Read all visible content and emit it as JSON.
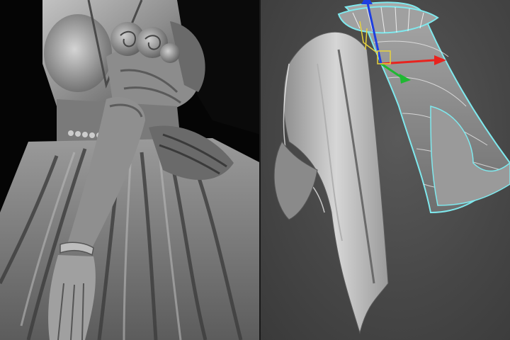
{
  "panels": {
    "left": {
      "render_mode": "sculpt-clay-render",
      "subject": "figure-dress-closeup"
    },
    "right": {
      "render_mode": "viewport-shaded-with-selection",
      "subject": "layered-skirt-mesh"
    }
  },
  "colors": {
    "left_background": "#050505",
    "clay_light": "#b9b9b9",
    "clay_mid": "#8a8a8a",
    "clay_dark": "#3c3c3c",
    "viewport_background": "#4a4a4a",
    "selection_outline": "#7fe9ee",
    "gizmo_x": "#e8231e",
    "gizmo_y": "#1fb832",
    "gizmo_z": "#1f3fe0",
    "wire_yellow": "#e8d23c"
  },
  "gizmo": {
    "axes": [
      "x-axis",
      "y-axis",
      "z-axis"
    ]
  }
}
